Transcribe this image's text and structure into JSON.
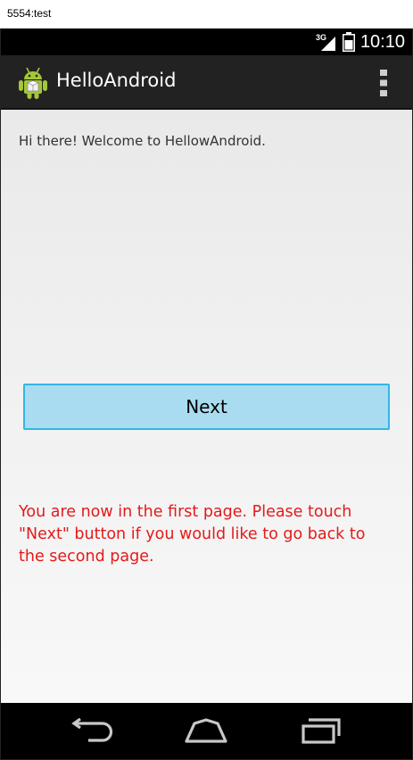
{
  "window": {
    "title": "5554:test"
  },
  "status_bar": {
    "network": "3G",
    "time": "10:10"
  },
  "action_bar": {
    "title": "HelloAndroid",
    "icons": {
      "app": "android-robot-icon",
      "overflow": "overflow-menu-icon"
    }
  },
  "content": {
    "welcome": "Hi there! Welcome to HellowAndroid.",
    "next_button": "Next",
    "info": "You are now in the first page. Please touch \"Next\" button if you would like to go back to the second page."
  },
  "nav_bar": {
    "icons": [
      "back-icon",
      "home-icon",
      "recent-apps-icon"
    ]
  },
  "colors": {
    "action_bar": "#222222",
    "button_fill": "#a9dcf0",
    "button_border": "#33b5e5",
    "info_text": "#e41a1a",
    "android_green": "#a4c639"
  }
}
